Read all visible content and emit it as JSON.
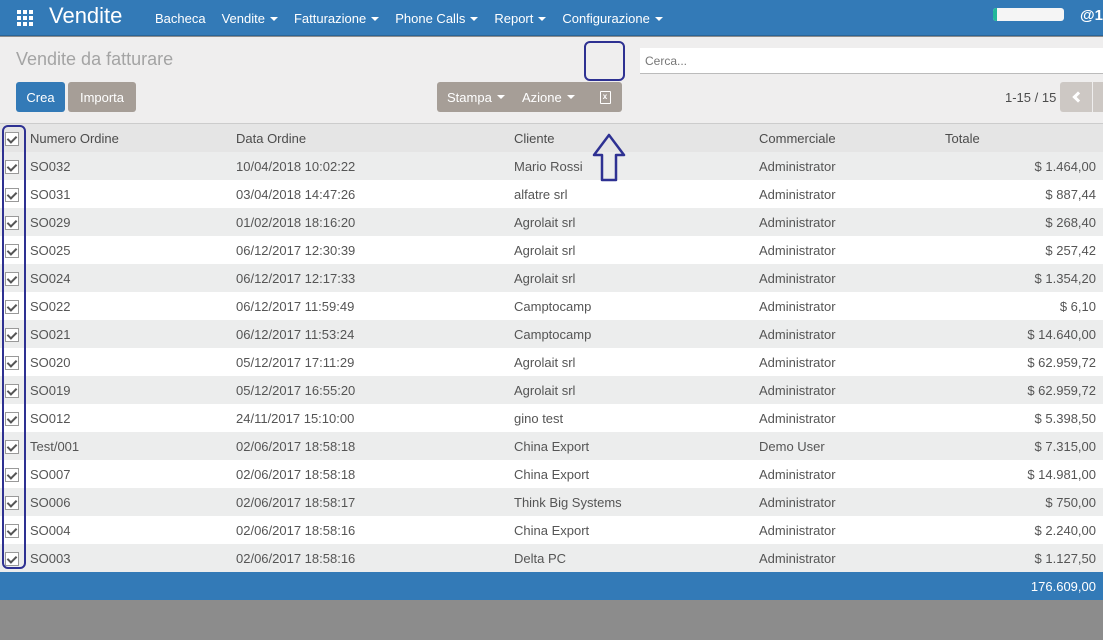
{
  "navbar": {
    "app_title": "Vendite",
    "menu": [
      {
        "label": "Bacheca",
        "dropdown": false
      },
      {
        "label": "Vendite",
        "dropdown": true
      },
      {
        "label": "Fatturazione",
        "dropdown": true
      },
      {
        "label": "Phone Calls",
        "dropdown": true
      },
      {
        "label": "Report",
        "dropdown": true
      },
      {
        "label": "Configurazione",
        "dropdown": true
      }
    ],
    "user_prefix": "@1"
  },
  "control_panel": {
    "title": "Vendite da fatturare",
    "search_placeholder": "Cerca...",
    "create_label": "Crea",
    "import_label": "Importa",
    "print_label": "Stampa",
    "action_label": "Azione",
    "export_icon": "excel-export-icon",
    "pager": "1-15 / 15"
  },
  "table": {
    "headers": [
      "Numero Ordine",
      "Data Ordine",
      "Cliente",
      "Commerciale",
      "Totale"
    ],
    "rows": [
      {
        "num": "SO032",
        "date": "10/04/2018 10:02:22",
        "client": "Mario Rossi",
        "salesperson": "Administrator",
        "total": "$ 1.464,00"
      },
      {
        "num": "SO031",
        "date": "03/04/2018 14:47:26",
        "client": "alfatre srl",
        "salesperson": "Administrator",
        "total": "$ 887,44"
      },
      {
        "num": "SO029",
        "date": "01/02/2018 18:16:20",
        "client": "Agrolait srl",
        "salesperson": "Administrator",
        "total": "$ 268,40"
      },
      {
        "num": "SO025",
        "date": "06/12/2017 12:30:39",
        "client": "Agrolait srl",
        "salesperson": "Administrator",
        "total": "$ 257,42"
      },
      {
        "num": "SO024",
        "date": "06/12/2017 12:17:33",
        "client": "Agrolait srl",
        "salesperson": "Administrator",
        "total": "$ 1.354,20"
      },
      {
        "num": "SO022",
        "date": "06/12/2017 11:59:49",
        "client": "Camptocamp",
        "salesperson": "Administrator",
        "total": "$ 6,10"
      },
      {
        "num": "SO021",
        "date": "06/12/2017 11:53:24",
        "client": "Camptocamp",
        "salesperson": "Administrator",
        "total": "$ 14.640,00"
      },
      {
        "num": "SO020",
        "date": "05/12/2017 17:11:29",
        "client": "Agrolait srl",
        "salesperson": "Administrator",
        "total": "$ 62.959,72"
      },
      {
        "num": "SO019",
        "date": "05/12/2017 16:55:20",
        "client": "Agrolait srl",
        "salesperson": "Administrator",
        "total": "$ 62.959,72"
      },
      {
        "num": "SO012",
        "date": "24/11/2017 15:10:00",
        "client": "gino test",
        "salesperson": "Administrator",
        "total": "$ 5.398,50"
      },
      {
        "num": "Test/001",
        "date": "02/06/2017 18:58:18",
        "client": "China Export",
        "salesperson": "Demo User",
        "total": "$ 7.315,00"
      },
      {
        "num": "SO007",
        "date": "02/06/2017 18:58:18",
        "client": "China Export",
        "salesperson": "Administrator",
        "total": "$ 14.981,00"
      },
      {
        "num": "SO006",
        "date": "02/06/2017 18:58:17",
        "client": "Think Big Systems",
        "salesperson": "Administrator",
        "total": "$ 750,00"
      },
      {
        "num": "SO004",
        "date": "02/06/2017 18:58:16",
        "client": "China Export",
        "salesperson": "Administrator",
        "total": "$ 2.240,00"
      },
      {
        "num": "SO003",
        "date": "02/06/2017 18:58:16",
        "client": "Delta PC",
        "salesperson": "Administrator",
        "total": "$ 1.127,50"
      }
    ],
    "footer_total": "176.609,00",
    "all_selected": true
  },
  "colors": {
    "primary": "#337ab7",
    "secondary": "#a69e97",
    "annotation": "#2e3192"
  }
}
